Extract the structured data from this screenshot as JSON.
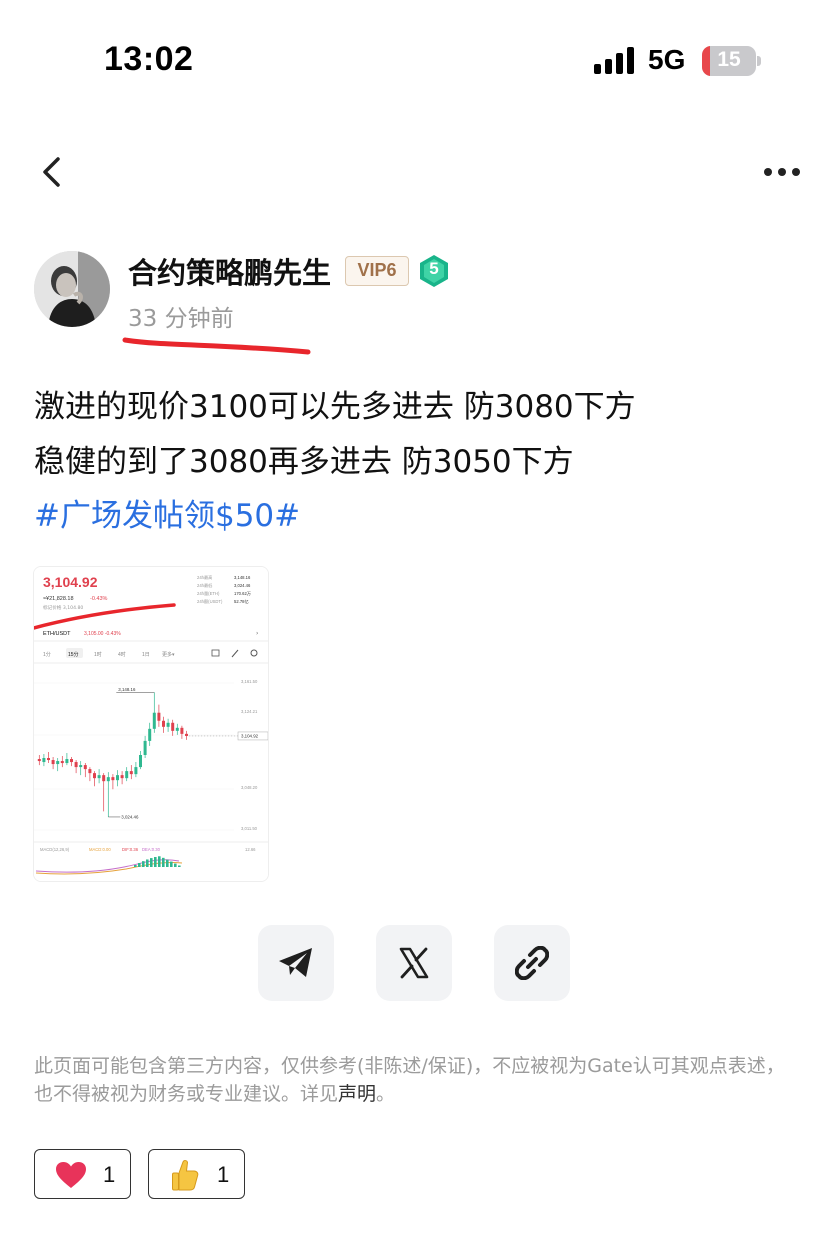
{
  "status_bar": {
    "time": "13:02",
    "network": "5G",
    "battery": "15",
    "battery_level": 0.15
  },
  "nav": {
    "back_icon": "chevron-left-icon",
    "more_icon": "more-horizontal-icon"
  },
  "author": {
    "name": "合约策略鹏先生",
    "vip": "VIP6",
    "level": "5",
    "time_ago": "33 分钟前"
  },
  "post": {
    "lines": [
      "激进的现价3100可以先多进去 防3080下方",
      "稳健的到了3080再多进去 防3050下方"
    ],
    "hashtag": "#广场发帖领$50#"
  },
  "image": {
    "price": "3,104.92",
    "cny_line": "≈¥21,828.18",
    "change": "-0.43%",
    "mark_price": "标记价格 3,104.80",
    "stats": [
      {
        "label": "24h最高",
        "value": "3,148.16"
      },
      {
        "label": "24h最低",
        "value": "3,024.46"
      },
      {
        "label": "24h量(ETH)",
        "value": "170.62万"
      },
      {
        "label": "24h额(USDT)",
        "value": "52.78亿"
      }
    ],
    "pair": "ETH/USDT",
    "pair_price": "3,105.00 -0.43%",
    "timeframes": [
      "1分",
      "15分",
      "1时",
      "4时",
      "1日",
      "更多▾"
    ],
    "high_label": "3,148.16",
    "low_label": "3,024.46",
    "current_label": "3,104.92",
    "axis_labels": [
      "3,161.50",
      "3,124.21",
      "3,088.00",
      "3,048.20",
      "3,011.50"
    ],
    "indicator_labels": [
      "MACD(12,26,9)",
      "MACD:0.00",
      "DIF:0.36",
      "DEA:0.30",
      "12.66"
    ],
    "candles": [
      [
        3082,
        3080,
        3086,
        3076
      ],
      [
        3079,
        3083,
        3087,
        3075
      ],
      [
        3083,
        3081,
        3089,
        3078
      ],
      [
        3081,
        3077,
        3084,
        3072
      ],
      [
        3077,
        3080,
        3083,
        3070
      ],
      [
        3080,
        3078,
        3085,
        3074
      ],
      [
        3078,
        3082,
        3088,
        3076
      ],
      [
        3082,
        3079,
        3084,
        3075
      ],
      [
        3079,
        3074,
        3081,
        3068
      ],
      [
        3074,
        3076,
        3080,
        3066
      ],
      [
        3076,
        3072,
        3078,
        3064
      ],
      [
        3072,
        3068,
        3074,
        3060
      ],
      [
        3068,
        3063,
        3070,
        3055
      ],
      [
        3063,
        3066,
        3072,
        3058
      ],
      [
        3066,
        3060,
        3068,
        3030
      ],
      [
        3060,
        3064,
        3069,
        3024.46
      ],
      [
        3064,
        3061,
        3067,
        3052
      ],
      [
        3061,
        3066,
        3071,
        3055
      ],
      [
        3066,
        3063,
        3070,
        3057
      ],
      [
        3063,
        3070,
        3074,
        3060
      ],
      [
        3070,
        3067,
        3076,
        3062
      ],
      [
        3067,
        3074,
        3079,
        3064
      ],
      [
        3074,
        3086,
        3090,
        3072
      ],
      [
        3086,
        3100,
        3105,
        3083
      ],
      [
        3100,
        3112,
        3118,
        3095
      ],
      [
        3112,
        3128,
        3148.16,
        3108
      ],
      [
        3128,
        3120,
        3136,
        3114
      ],
      [
        3120,
        3114,
        3124,
        3108
      ],
      [
        3114,
        3118,
        3122,
        3109
      ],
      [
        3118,
        3110,
        3121,
        3105
      ],
      [
        3110,
        3113,
        3117,
        3106
      ],
      [
        3113,
        3107,
        3115,
        3102
      ],
      [
        3107,
        3104.92,
        3110,
        3101
      ]
    ]
  },
  "share": [
    "telegram-icon",
    "x-icon",
    "link-icon"
  ],
  "disclaimer": {
    "text": "此页面可能包含第三方内容，仅供参考(非陈述/保证)，不应被视为Gate认可其观点表述，也不得被视为财务或专业建议。详见",
    "link": "声明",
    "end": "。"
  },
  "reactions": [
    {
      "icon": "heart-icon",
      "count": "1"
    },
    {
      "icon": "thumbs-up-icon",
      "count": "1"
    }
  ],
  "colors": {
    "hashtag": "#2a6fe0",
    "up": "#2fb890",
    "down": "#e0414e",
    "annotation_red": "#e8262c"
  }
}
